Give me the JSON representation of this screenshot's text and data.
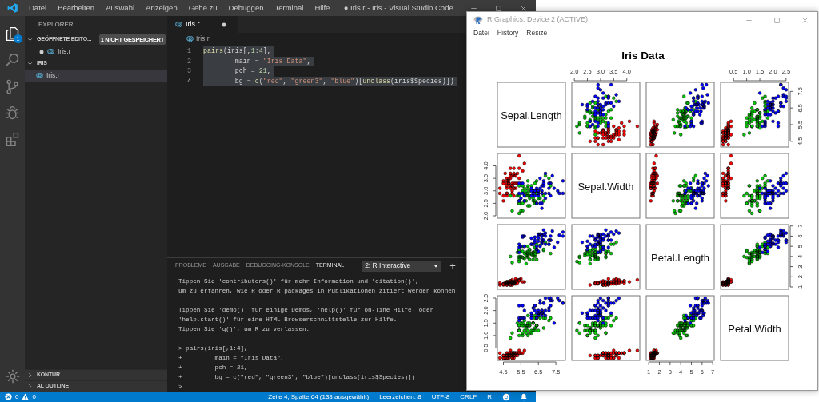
{
  "window": {
    "title": "● Iris.r - Iris - Visual Studio Code"
  },
  "menu": [
    "Datei",
    "Bearbeiten",
    "Auswahl",
    "Anzeigen",
    "Gehe zu",
    "Debuggen",
    "Terminal",
    "Hilfe"
  ],
  "activity_bar": [
    {
      "kind": "explorer",
      "selected": true,
      "badge": "1"
    },
    {
      "kind": "search",
      "selected": false
    },
    {
      "kind": "scm",
      "selected": false
    },
    {
      "kind": "debug",
      "selected": false
    },
    {
      "kind": "extensions",
      "selected": false
    }
  ],
  "sidebar": {
    "title": "EXPLORER",
    "sections": [
      {
        "title": "GEÖFFNETE EDITO...",
        "expanded": true,
        "badge": "1 NICHT GESPEICHERT",
        "items": [
          {
            "label": "Iris.r",
            "modified": true,
            "selected": false
          }
        ]
      },
      {
        "title": "IRIS",
        "expanded": true,
        "items": [
          {
            "label": "Iris.r",
            "modified": false,
            "selected": true
          }
        ]
      }
    ],
    "bottom_sections": [
      {
        "title": "KONTUR",
        "expanded": false
      },
      {
        "title": "AL OUTLINE",
        "expanded": false
      }
    ]
  },
  "editor": {
    "tabs": [
      {
        "label": "Iris.r",
        "modified": true,
        "selected": true
      }
    ],
    "breadcrumb": "Iris.r",
    "lines": [
      {
        "number": "1",
        "current": false,
        "selected": true,
        "tokens": [
          {
            "kind": "function",
            "text": "pairs"
          },
          {
            "kind": "plain",
            "text": "(iris[,"
          },
          {
            "kind": "number",
            "text": "1"
          },
          {
            "kind": "plain",
            "text": ":"
          },
          {
            "kind": "number",
            "text": "4"
          },
          {
            "kind": "plain",
            "text": "],"
          }
        ]
      },
      {
        "number": "2",
        "current": false,
        "selected": true,
        "tokens": [
          {
            "kind": "plain",
            "text": "        main = "
          },
          {
            "kind": "string",
            "text": "\"Iris Data\""
          },
          {
            "kind": "plain",
            "text": ","
          }
        ]
      },
      {
        "number": "3",
        "current": false,
        "selected": true,
        "tokens": [
          {
            "kind": "plain",
            "text": "        pch = "
          },
          {
            "kind": "number",
            "text": "21"
          },
          {
            "kind": "plain",
            "text": ","
          }
        ]
      },
      {
        "number": "4",
        "current": true,
        "selected": true,
        "tokens": [
          {
            "kind": "plain",
            "text": "        bg = "
          },
          {
            "kind": "function",
            "text": "c"
          },
          {
            "kind": "plain",
            "text": "("
          },
          {
            "kind": "string",
            "text": "\"red\""
          },
          {
            "kind": "plain",
            "text": ", "
          },
          {
            "kind": "string",
            "text": "\"green3\""
          },
          {
            "kind": "plain",
            "text": ", "
          },
          {
            "kind": "string",
            "text": "\"blue\""
          },
          {
            "kind": "plain",
            "text": ")["
          },
          {
            "kind": "function",
            "text": "unclass"
          },
          {
            "kind": "plain",
            "text": "(iris$Species)])"
          }
        ]
      }
    ]
  },
  "panel": {
    "tabs": [
      {
        "label": "PROBLEME",
        "selected": false
      },
      {
        "label": "AUSGABE",
        "selected": false
      },
      {
        "label": "DEBUGGING-KONSOLE",
        "selected": false
      },
      {
        "label": "TERMINAL",
        "selected": true
      }
    ],
    "terminal_select": "2: R Interactive",
    "add_button": "+",
    "terminal_blocks": [
      [
        "Tippen Sie 'contributors()' für mehr Information und 'citation()',",
        "um zu erfahren, wie R oder R packages in Publikationen zitiert werden können."
      ],
      [
        "Tippen Sie 'demo()' für einige Demos, 'help()' für on-line Hilfe, oder",
        "'help.start()' für eine HTML Browserschnittstelle zur Hilfe.",
        "Tippen Sie 'q()', um R zu verlassen."
      ],
      [
        "> pairs(iris[,1:4],",
        "+         main = \"Iris Data\",",
        "+         pch = 21,",
        "+         bg = c(\"red\", \"green3\", \"blue\")[unclass(iris$Species)])",
        ">"
      ]
    ]
  },
  "status_bar": {
    "errors": "0",
    "warnings": "0",
    "items": [
      "Zeile 4, Spalte 64 (133 ausgewählt)",
      "Leerzeichen: 8",
      "UTF-8",
      "CRLF",
      "R"
    ]
  },
  "graphics_window": {
    "title": "R Graphics: Device 2 (ACTIVE)",
    "menu": [
      "Datei",
      "History",
      "Resize"
    ],
    "plot": {
      "title": "Iris Data",
      "variables": [
        {
          "name": "Sepal.Length",
          "x_ticks": [
            "4.5",
            "5.5",
            "6.5",
            "7.5"
          ],
          "y_ticks": [
            "4.5",
            "5.5",
            "6.5",
            "7.5"
          ]
        },
        {
          "name": "Sepal.Width",
          "x_ticks": [
            "2.0",
            "2.5",
            "3.0",
            "3.5",
            "4.0"
          ],
          "y_ticks": [
            "2.0",
            "2.5",
            "3.0",
            "3.5",
            "4.0"
          ]
        },
        {
          "name": "Petal.Length",
          "x_ticks": [
            "1",
            "2",
            "3",
            "4",
            "5",
            "6",
            "7"
          ],
          "y_ticks": [
            "1",
            "2",
            "3",
            "4",
            "5",
            "6",
            "7"
          ]
        },
        {
          "name": "Petal.Width",
          "x_ticks": [
            "0.5",
            "1.0",
            "1.5",
            "2.0",
            "2.5"
          ],
          "y_ticks": [
            "0.5",
            "1.0",
            "1.5",
            "2.0",
            "2.5"
          ]
        }
      ]
    }
  }
}
